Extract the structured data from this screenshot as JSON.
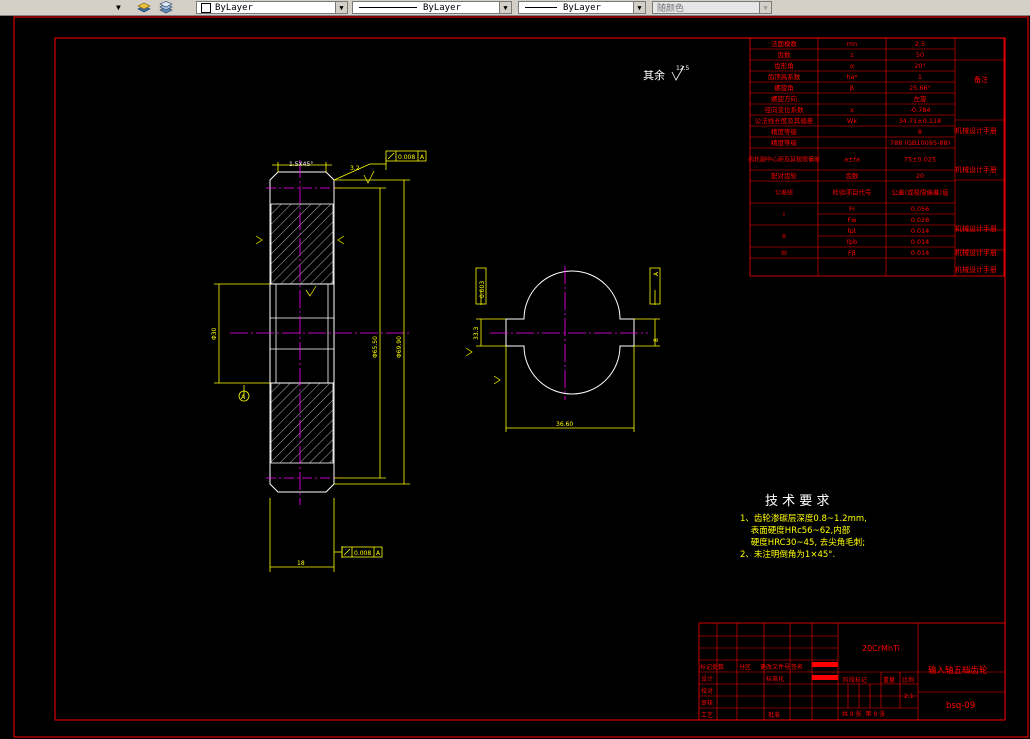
{
  "toolbar": {
    "layer_value": "ByLayer",
    "linetype_value": "ByLayer",
    "lineweight_value": "ByLayer",
    "color_value": "随颜色",
    "layers_icon": "layers-icon",
    "layer_states_icon": "layer-states-icon"
  },
  "drawing": {
    "roughness_note": "其余",
    "roughness_value": "12.5",
    "chamfer_label": "1.5X45°",
    "roughness_top": "3.2",
    "tolerance_top": "0.008",
    "datum_top": "A",
    "tolerance_bottom": "0.008",
    "datum_bottom": "A",
    "width_dim": "18",
    "pitch_dia": "Φ65.50",
    "tip_dia": "Φ69.90",
    "bore_dia": "Φ30",
    "datum_label": "A",
    "keyway_width": "8",
    "keyway_height": "33.3",
    "keyway_len": "36.60",
    "tolerance_side": "0.003",
    "datum_side": "A"
  },
  "param_table": {
    "rows": [
      {
        "name": "法面模数",
        "sym": "mn",
        "val": "2.5"
      },
      {
        "name": "齿数",
        "sym": "z",
        "val": "50"
      },
      {
        "name": "齿形角",
        "sym": "α",
        "val": "20°"
      },
      {
        "name": "齿顶高系数",
        "sym": "ha*",
        "val": "1"
      },
      {
        "name": "螺旋角",
        "sym": "β",
        "val": "25.66°"
      },
      {
        "name": "螺旋方向",
        "sym": "",
        "val": "左旋"
      },
      {
        "name": "径向变位系数",
        "sym": "x",
        "val": "-0.784"
      },
      {
        "name": "公法线长度及其偏差",
        "sym": "Wk",
        "val": "34.71±0.118"
      },
      {
        "name": "精度等级",
        "sym": "",
        "val": "8"
      },
      {
        "name": "精度等级",
        "sym": "",
        "val": "788 (GB10095-88)"
      },
      {
        "name": "齿轮副中心距及其极限偏差",
        "sym": "a±fa",
        "val": "75±0.025"
      },
      {
        "name": "配对齿轮",
        "sym": "齿数",
        "val": "20"
      },
      {
        "name": "公差组",
        "sym": "检验项目代号",
        "val": "公差(或极限偏差)值"
      }
    ],
    "groups": [
      {
        "id": "I",
        "items": [
          {
            "sym": "Fr",
            "val": "0.056"
          },
          {
            "sym": "Fw",
            "val": "0.028"
          }
        ]
      },
      {
        "id": "II",
        "items": [
          {
            "sym": "fpt",
            "val": "0.014"
          },
          {
            "sym": "fpb",
            "val": "0.014"
          }
        ]
      },
      {
        "id": "III",
        "items": [
          {
            "sym": "Fβ",
            "val": "0.014"
          }
        ]
      }
    ],
    "notes": {
      "top": "备注",
      "ref": "机械设计手册"
    }
  },
  "tech_req": {
    "title": "技 术 要 求",
    "lines": [
      "1、齿轮渗碳层深度0.8~1.2mm,",
      "    表面硬度HRc56~62,内部",
      "    硬度HRC30~45, 去尖角毛刺;",
      "2、未注明倒角为1×45°."
    ]
  },
  "title_block": {
    "material": "20CrMnTi",
    "part_name": "输入轴五档齿轮",
    "drawing_no": "bsq-09",
    "scale_label": "比例",
    "scale": "2:1",
    "weight_label": "重量",
    "stage_label": "阶段标记",
    "sheet_text": "共 9 张  第 9 张",
    "rows": [
      "标记处数",
      "设计",
      "校对",
      "审核",
      "工艺"
    ],
    "cols": [
      "分区",
      "更改文件号",
      "签名"
    ],
    "std": "标准化",
    "approve": "批准"
  }
}
